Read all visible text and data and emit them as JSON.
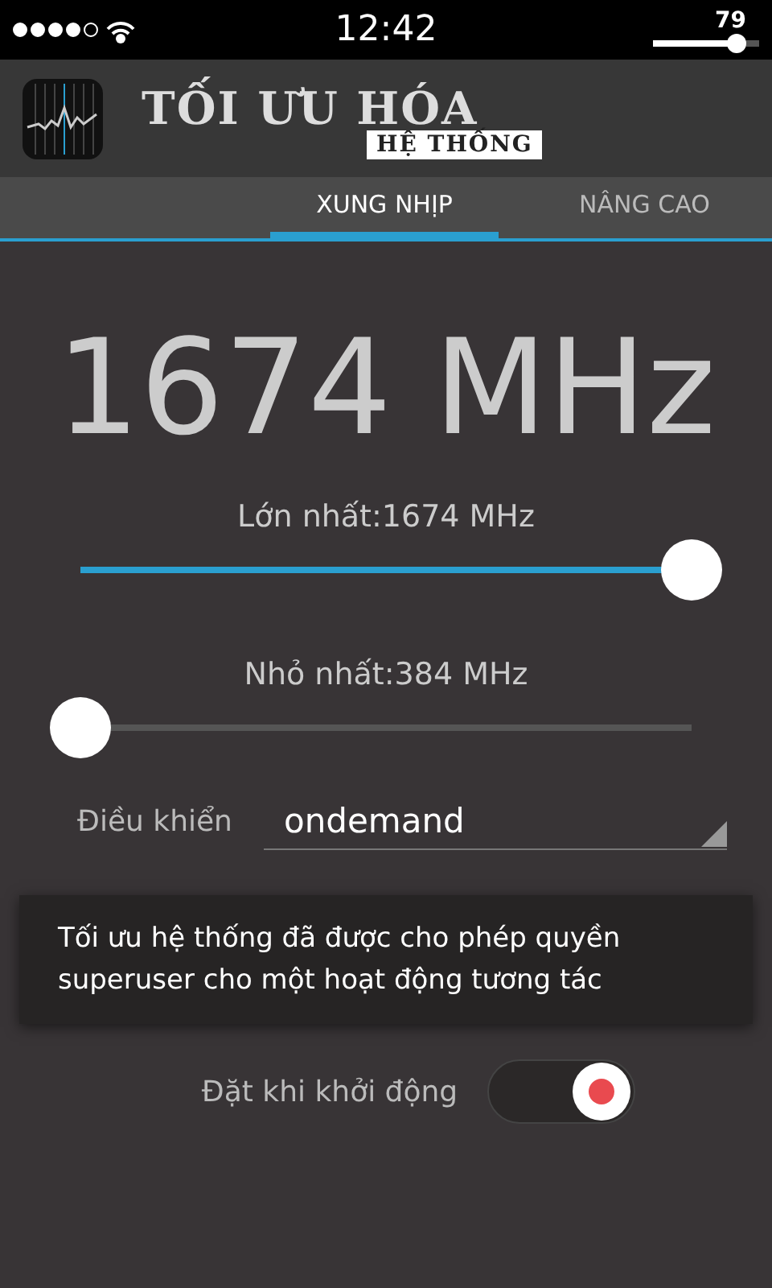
{
  "status_bar": {
    "time": "12:42",
    "battery": "79"
  },
  "app_header": {
    "title": "TỐI ƯU HÓA",
    "subtitle": "HỆ THỐNG"
  },
  "tabs": [
    {
      "label": "XUNG NHỊP",
      "selected": true
    },
    {
      "label": "NÂNG CAO",
      "selected": false
    }
  ],
  "frequency": "1674 MHz",
  "sliders": [
    {
      "label": "Lớn nhất:1674 MHz",
      "level": 1
    },
    {
      "label": "Nhỏ nhất:384 MHz",
      "level": 0
    }
  ],
  "governor": {
    "label": "Điều khiển",
    "value": "ondemand"
  },
  "toast": "Tối ưu hệ thống đã được cho phép quyền superuser cho một hoạt động tương tác",
  "boot_toggle": {
    "label": "Đặt khi khởi động",
    "on": true
  }
}
